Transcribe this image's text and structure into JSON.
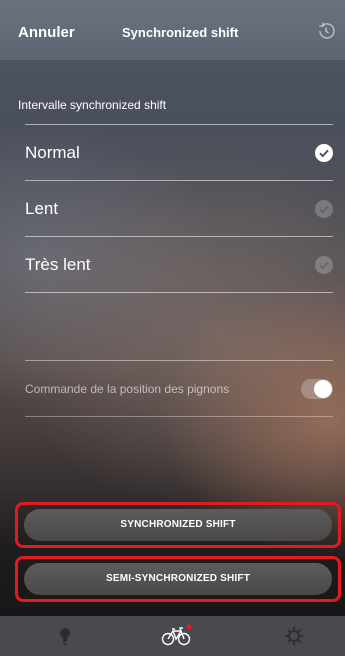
{
  "header": {
    "cancel_label": "Annuler",
    "title": "Synchronized shift",
    "history_icon": "history-icon"
  },
  "interval": {
    "section_label": "Intervalle synchronized shift",
    "options": [
      {
        "label": "Normal",
        "selected": true
      },
      {
        "label": "Lent",
        "selected": false
      },
      {
        "label": "Très lent",
        "selected": false
      }
    ]
  },
  "sprocket_control": {
    "label": "Commande de la position des pignons",
    "enabled": true
  },
  "buttons": {
    "synchronized_label": "SYNCHRONIZED SHIFT",
    "semi_synchronized_label": "SEMI-SYNCHRONIZED SHIFT"
  },
  "tabbar": {
    "items": [
      {
        "icon": "bulb-icon",
        "active": false
      },
      {
        "icon": "bike-icon",
        "active": true,
        "badge": true
      },
      {
        "icon": "gear-icon",
        "active": false
      }
    ],
    "badge_color": "#e21b23"
  },
  "colors": {
    "highlight_frame": "#e21b23",
    "header_bg": "#6b7280"
  }
}
